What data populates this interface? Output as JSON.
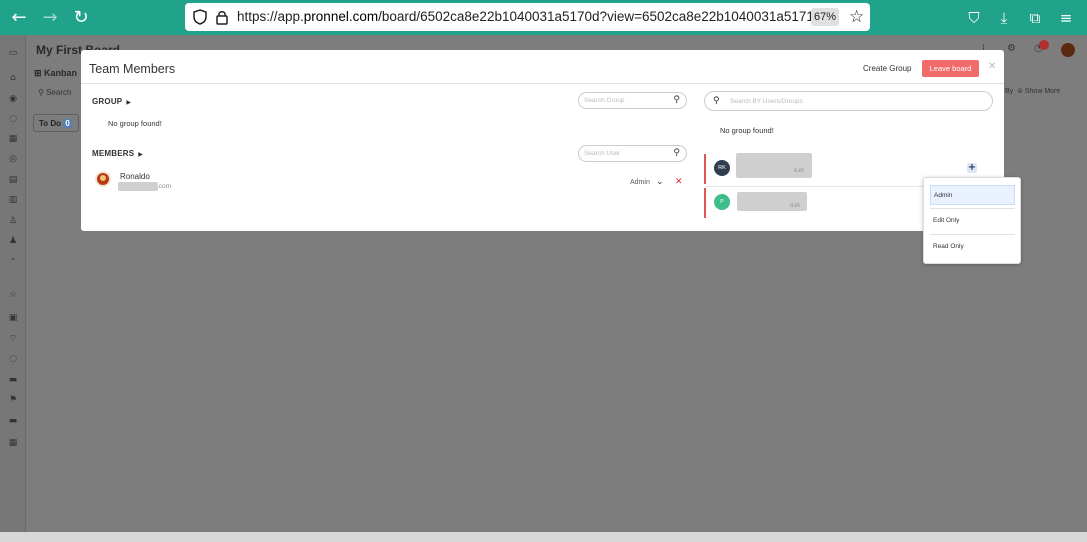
{
  "browser": {
    "url_prefix": "https://app.",
    "url_domain": "pronnel.com",
    "url_path": "/board/6502ca8e22b1040031a5170d?view=6502ca8e22b1040031a51715",
    "zoom": "67%"
  },
  "app": {
    "board_title": "My First Board",
    "view_tab": "Kanban",
    "search_label": "Search",
    "column_name": "To Do",
    "column_count": "0",
    "by_label": "By",
    "show_more_label": "Show More",
    "notification_count": "0"
  },
  "modal": {
    "title": "Team Members",
    "create_group_label": "Create Group",
    "leave_board_label": "Leave board",
    "group_section": {
      "label": "GROUP",
      "search_placeholder": "Search Group",
      "empty_text": "No group found!"
    },
    "members_section": {
      "label": "MEMBERS",
      "search_placeholder": "Search User",
      "members": [
        {
          "name": "Ronaldo",
          "email_suffix": ".com",
          "role": "Admin"
        }
      ]
    },
    "right_panel": {
      "search_placeholder": "Search BY Users/Groups",
      "empty_group_text": "No group found!",
      "users": [
        {
          "initials": "RK",
          "email_suffix": "o.in",
          "avatar_color": "#2f3e4e"
        },
        {
          "initials": "P",
          "email_suffix": "o.in",
          "avatar_color": "#3dbd8a"
        }
      ]
    },
    "role_dropdown": {
      "options": [
        "Admin",
        "Edit Only",
        "Read Only"
      ],
      "selected": "Admin"
    }
  },
  "colors": {
    "browser_bar": "#20a38a",
    "leave_button": "#f26b6b",
    "remove_icon": "#e02a2a",
    "user_row_accent": "#e05555"
  }
}
